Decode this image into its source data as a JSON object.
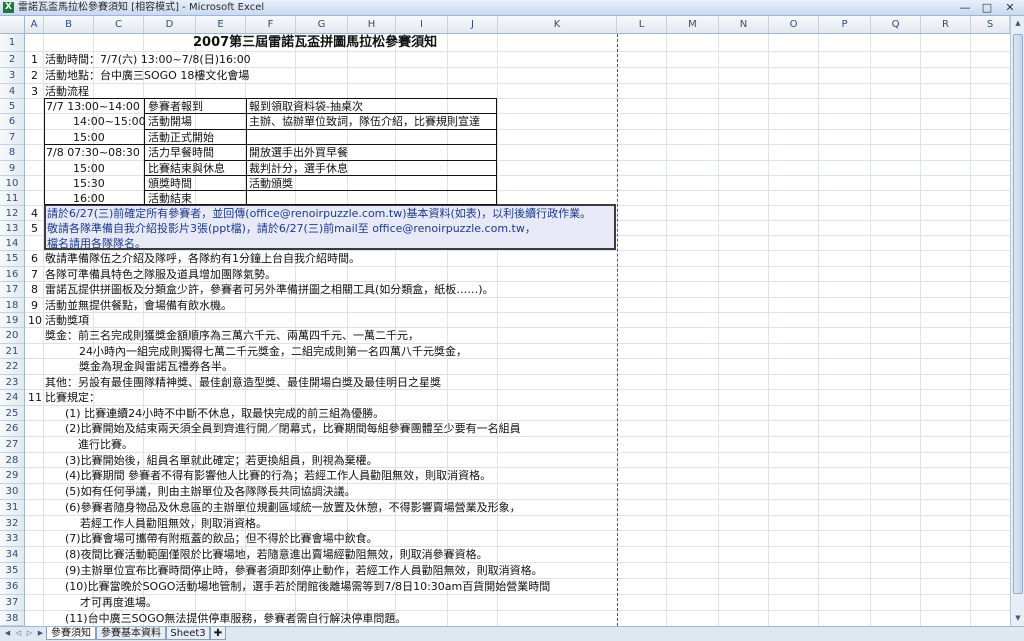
{
  "window": {
    "title": "雷諾瓦盃馬拉松參賽須知 [相容模式] - Microsoft Excel",
    "app_icon": "excel-icon",
    "controls": {
      "minimize": "—",
      "maximize": "□",
      "close": "✕"
    }
  },
  "columns": [
    "A",
    "B",
    "C",
    "D",
    "E",
    "F",
    "G",
    "H",
    "I",
    "J",
    "K",
    "L",
    "M",
    "N",
    "O",
    "P",
    "Q",
    "R",
    "S"
  ],
  "rows": [
    "1",
    "2",
    "3",
    "4",
    "5",
    "6",
    "7",
    "8",
    "9",
    "10",
    "11",
    "12",
    "13",
    "14",
    "15",
    "16",
    "17",
    "18",
    "19",
    "20",
    "21",
    "22",
    "23",
    "24",
    "25",
    "26",
    "27",
    "28",
    "29",
    "30",
    "31",
    "32",
    "33",
    "34",
    "35",
    "36",
    "37",
    "38"
  ],
  "cells": {
    "title": "2007第三屆雷諾瓦盃拼圖馬拉松參賽須知",
    "r2a": "1",
    "r2b": "活動時間：7/7(六) 13:00~7/8(日)16:00",
    "r3a": "2",
    "r3b": "活動地點：台中廣三SOGO 18樓文化會場",
    "r4a": "3",
    "r4b": "活動流程",
    "r5b": "7/7   13:00~14:00",
    "r5d": "參賽者報到",
    "r5f": "報到領取資料袋-抽桌次",
    "r6b": "14:00~15:00",
    "r6d": "活動開場",
    "r6f": "主辦、協辦單位致詞，隊伍介紹，比賽規則宣達",
    "r7b": "15:00",
    "r7d": "活動正式開始",
    "r8b": "7/8   07:30~08:30",
    "r8d": "活力早餐時間",
    "r8f": "開放選手出外買早餐",
    "r9b": "15:00",
    "r9d": "比賽結束與休息",
    "r9f": "裁判計分，選手休息",
    "r10b": "15:30",
    "r10d": "頒獎時間",
    "r10f": "活動頒獎",
    "r11b": "16:00",
    "r11d": "活動結束",
    "r12a": "4",
    "r12b": "請於6/27(三)前確定所有參賽者，並回傳(office@renoirpuzzle.com.tw)基本資料(如表)，以利後續行政作業。",
    "r13a": "5",
    "r13b": "敬請各隊準備自我介紹投影片3張(ppt檔)，請於6/27(三)前mail至 office@renoirpuzzle.com.tw，",
    "r14b": "檔名請用各隊隊名。",
    "r15a": "6",
    "r15b": "敬請準備隊伍之介紹及隊呼，各隊約有1分鐘上台自我介紹時間。",
    "r16a": "7",
    "r16b": "各隊可準備具特色之隊服及道具增加團隊氣勢。",
    "r17a": "8",
    "r17b": "雷諾瓦提供拼圖板及分類盒少許，參賽者可另外準備拼圖之相關工具(如分類盒，紙板……)。",
    "r18a": "9",
    "r18b": "活動並無提供餐點，會場備有飲水機。",
    "r19a": "10",
    "r19b": "活動獎項",
    "r20b": "獎金：前三名完成則獲獎金額順序為三萬六千元、兩萬四千元、一萬二千元，",
    "r21b": "24小時內一組完成則獨得七萬二千元獎金，二組完成則第一名四萬八千元獎金，",
    "r22b": "獎金為現金與雷諾瓦禮券各半。",
    "r23b": "其他：另設有最佳團隊精神獎、最佳創意造型獎、最佳開場白獎及最佳明日之星獎",
    "r24a": "11",
    "r24b": "比賽規定：",
    "r25b": "(1) 比賽連續24小時不中斷不休息，取最快完成的前三組為優勝。",
    "r26b": "(2)比賽開始及結束兩天須全員到齊進行開／閉幕式，比賽期間每組參賽團體至少要有一名組員",
    "r27b": "進行比賽。",
    "r28b": "(3)比賽開始後，組員名單就此確定；若更換組員，則視為棄權。",
    "r29b": "(4)比賽期間 參賽者不得有影響他人比賽的行為；若經工作人員勸阻無效，則取消資格。",
    "r30b": "(5)如有任何爭議，則由主辦單位及各隊隊長共同協調決議。",
    "r31b": "(6)參賽者隨身物品及休息區的主辦單位規劃區域統一放置及休憩，不得影響賣場營業及形象，",
    "r32b": "若經工作人員勸阻無效，則取消資格。",
    "r33b": "(7)比賽會場可攜帶有附瓶蓋的飲品；但不得於比賽會場中飲食。",
    "r34b": "(8)夜間比賽活動範圍僅限於比賽場地，若隨意進出賣場經勸阻無效，則取消參賽資格。",
    "r35b": "(9)主辦單位宣布比賽時間停止時，參賽者須即刻停止動作，若經工作人員勸阻無效，則取消資格。",
    "r36b": "(10)比賽當晚於SOGO活動場地管制，選手若於閉館後離場需等到7/8日10:30am百貨開始營業時間",
    "r37b": "才可再度進場。",
    "r38b": "(11)台中廣三SOGO無法提供停車服務，參賽者需自行解決停車問題。"
  },
  "tabs": [
    "參賽須知",
    "參賽基本資料",
    "Sheet3"
  ],
  "active_tab": "參賽須知",
  "colors": {
    "selection_fill": "#e7eaf6",
    "blue_text": "#1d3b8f",
    "header_text": "#2e4e7a"
  }
}
